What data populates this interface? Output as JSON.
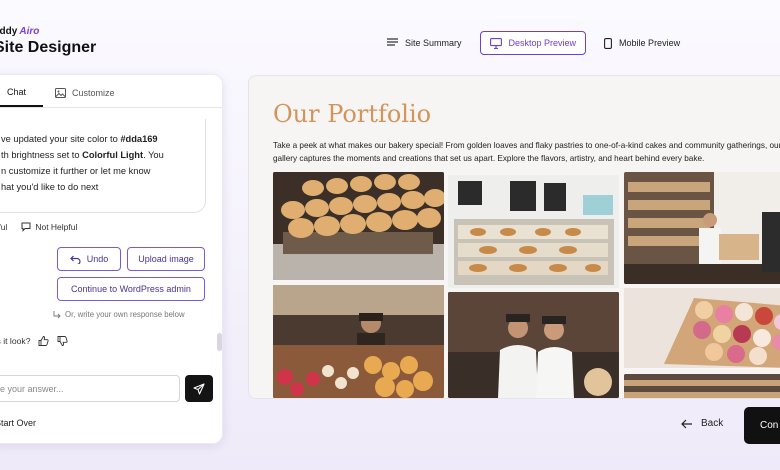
{
  "brand": {
    "prefix": "addy",
    "airo": "Airo",
    "title": "Site Designer"
  },
  "topnav": {
    "items": [
      {
        "label": "Site Summary",
        "icon": "list-icon"
      },
      {
        "label": "Desktop Preview",
        "icon": "monitor-icon",
        "active": true
      },
      {
        "label": "Mobile Preview",
        "icon": "phone-icon"
      }
    ]
  },
  "chat": {
    "tabs": [
      {
        "label": "Chat",
        "active": true
      },
      {
        "label": "Customize",
        "icon": "image-icon"
      }
    ],
    "message": {
      "line1_pre": "ve updated your site color to ",
      "line1_bold": "#dda169",
      "line2_pre": "th brightness set to ",
      "line2_bold": "Colorful Light",
      "line2_post": ". You",
      "line3": "n customize it further or let me know",
      "line4": "hat you'd like to do next"
    },
    "feedback": {
      "helpful": "elpful",
      "not_helpful": "Not Helpful"
    },
    "actions": {
      "undo": "Undo",
      "upload": "Upload image",
      "wordpress": "Continue to WordPress admin"
    },
    "hint": "Or, write your own response below",
    "look_question": "oes it look?",
    "input_placeholder": "e your answer...",
    "start_over": "Start Over"
  },
  "preview": {
    "title": "Our Portfolio",
    "description": "Take a peek at what makes our bakery special! From golden loaves and flaky pastries to one-of-a-kind cakes and community gatherings, our gallery captures the moments and creations that set us apart. Explore the flavors, artistry, and heart behind every bake."
  },
  "footer": {
    "back": "Back",
    "continue": "Con"
  },
  "colors": {
    "accent": "#6c3fd8",
    "portfolio_title": "#d1955c",
    "site_color": "#dda169"
  }
}
